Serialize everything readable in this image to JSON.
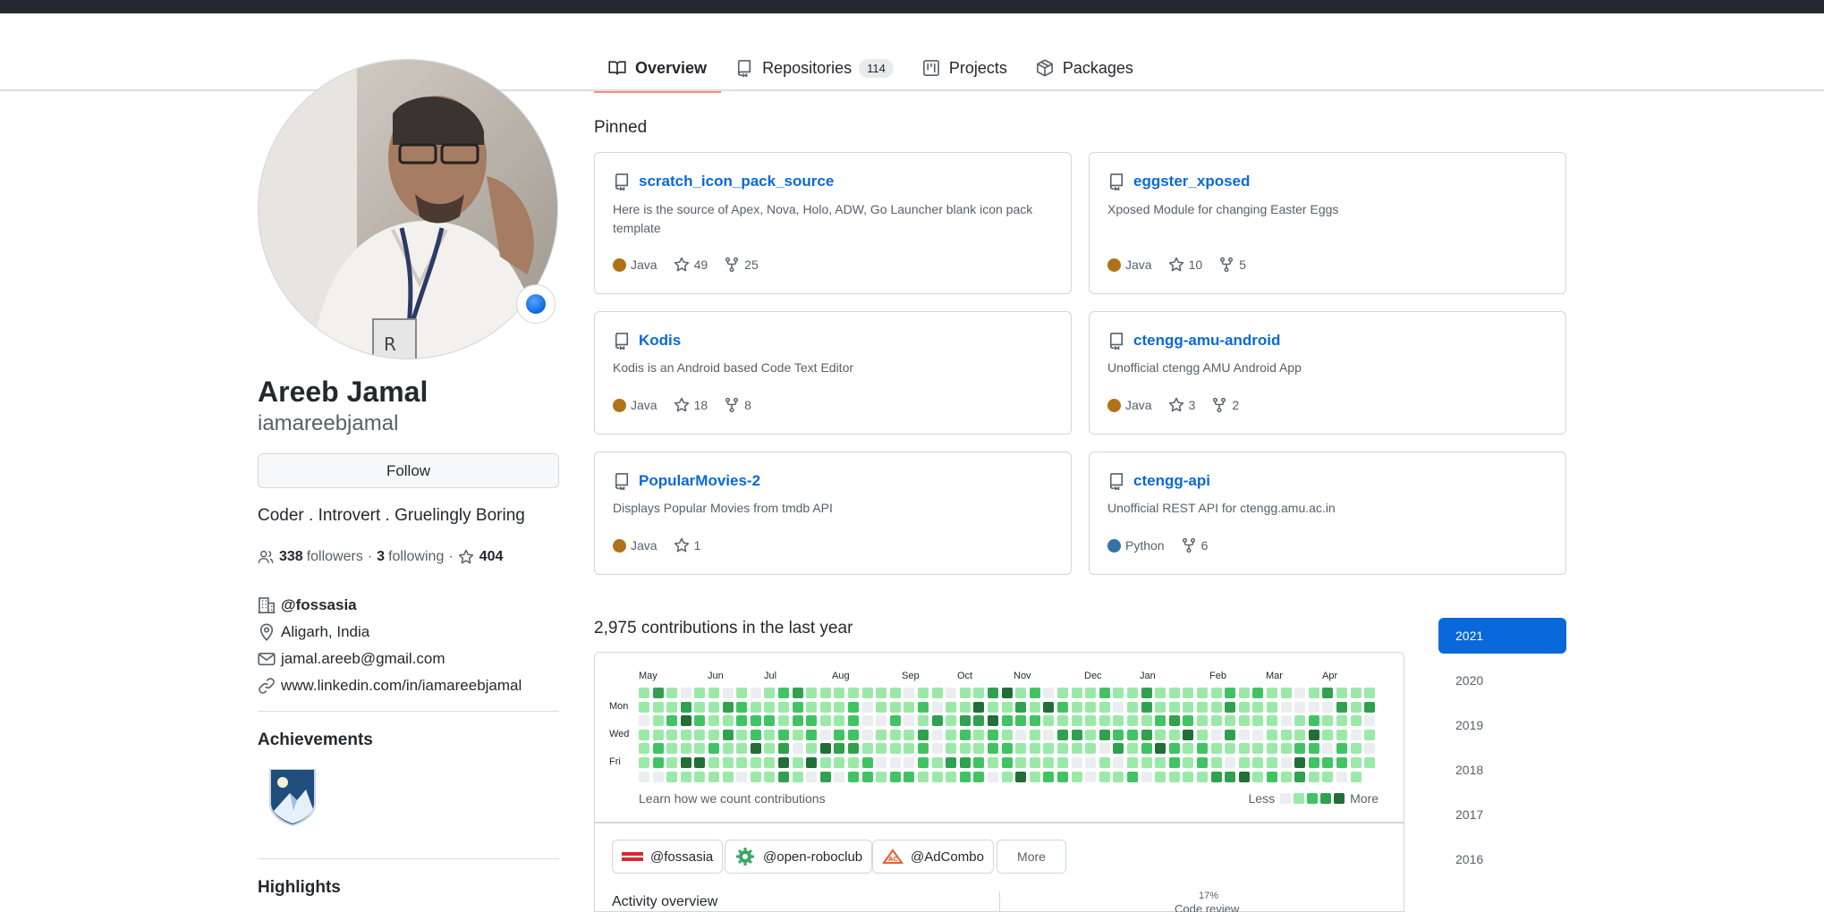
{
  "tabs": [
    {
      "label": "Overview",
      "icon": "book-icon",
      "active": true
    },
    {
      "label": "Repositories",
      "icon": "repo-icon",
      "count": "114"
    },
    {
      "label": "Projects",
      "icon": "project-icon"
    },
    {
      "label": "Packages",
      "icon": "package-icon"
    }
  ],
  "profile": {
    "name": "Areeb Jamal",
    "username": "iamareebjamal",
    "follow_label": "Follow",
    "bio": "Coder . Introvert . Gruelingly Boring",
    "followers": "338",
    "followers_label": "followers",
    "separator": "·",
    "following": "3",
    "following_label": "following",
    "stars": "404",
    "org": "@fossasia",
    "location": "Aligarh, India",
    "email": "jamal.areeb@gmail.com",
    "website": "www.linkedin.com/in/iamareebjamal",
    "achievements_title": "Achievements",
    "highlights_title": "Highlights"
  },
  "pinned": {
    "title": "Pinned",
    "repos": [
      {
        "name": "scratch_icon_pack_source",
        "desc": "Here is the source of Apex, Nova, Holo, ADW, Go Launcher blank icon pack template",
        "lang": "Java",
        "lang_color": "#b07219",
        "stars": "49",
        "forks": "25"
      },
      {
        "name": "eggster_xposed",
        "desc": "Xposed Module for changing Easter Eggs",
        "lang": "Java",
        "lang_color": "#b07219",
        "stars": "10",
        "forks": "5"
      },
      {
        "name": "Kodis",
        "desc": "Kodis is an Android based Code Text Editor",
        "lang": "Java",
        "lang_color": "#b07219",
        "stars": "18",
        "forks": "8"
      },
      {
        "name": "ctengg-amu-android",
        "desc": "Unofficial ctengg AMU Android App",
        "lang": "Java",
        "lang_color": "#b07219",
        "stars": "3",
        "forks": "2"
      },
      {
        "name": "PopularMovies-2",
        "desc": "Displays Popular Movies from tmdb API",
        "lang": "Java",
        "lang_color": "#b07219",
        "stars": "1"
      },
      {
        "name": "ctengg-api",
        "desc": "Unofficial REST API for ctengg.amu.ac.in",
        "lang": "Python",
        "lang_color": "#3572A5",
        "forks": "6"
      }
    ]
  },
  "contributions": {
    "title": "2,975 contributions in the last year",
    "months": [
      "May",
      "Jun",
      "Jul",
      "Aug",
      "Sep",
      "Oct",
      "Nov",
      "Dec",
      "Jan",
      "Feb",
      "Mar",
      "Apr"
    ],
    "day_labels": [
      "Mon",
      "Wed",
      "Fri"
    ],
    "learn_label": "Learn how we count contributions",
    "legend_less": "Less",
    "legend_more": "More",
    "level_colors": [
      "#ebedf0",
      "#9be9a8",
      "#40c463",
      "#30a14e",
      "#216e39"
    ]
  },
  "orgs": [
    {
      "name": "@fossasia",
      "logo": "FOSS ASIA"
    },
    {
      "name": "@open-roboclub",
      "logo": "gear"
    },
    {
      "name": "@AdCombo",
      "logo": "AC"
    }
  ],
  "more_label": "More",
  "activity": {
    "title": "Activity overview",
    "pct": "17%",
    "review_label": "Code review"
  },
  "years": [
    "2021",
    "2020",
    "2019",
    "2018",
    "2017",
    "2016"
  ]
}
